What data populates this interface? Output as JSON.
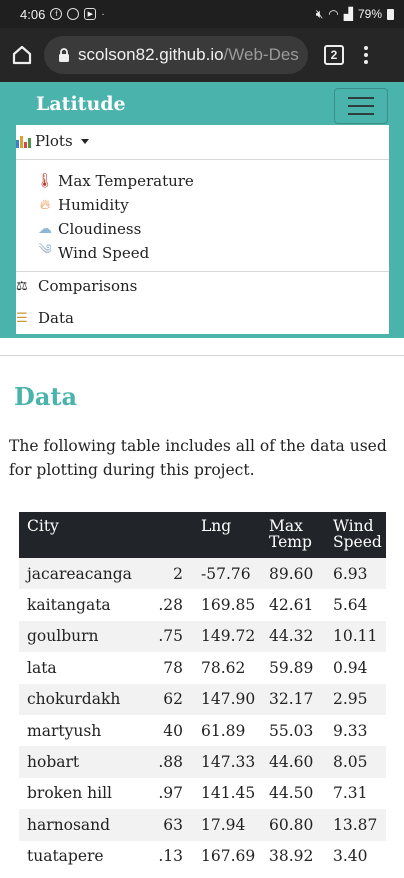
{
  "status_bar": {
    "time": "4:06",
    "battery": "79%"
  },
  "browser": {
    "url_host": "scolson82.github.io",
    "url_path": "/Web-Des",
    "tab_count": "2"
  },
  "navbar": {
    "brand": "Latitude",
    "plots_label": "Plots",
    "dropdown": [
      {
        "label": "Max Temperature",
        "icon": "thermometer-icon"
      },
      {
        "label": "Humidity",
        "icon": "fire-icon"
      },
      {
        "label": "Cloudiness",
        "icon": "cloud-icon"
      },
      {
        "label": "Wind Speed",
        "icon": "wind-icon"
      }
    ],
    "comparisons_label": "Comparisons",
    "data_label": "Data"
  },
  "page": {
    "title": "Data",
    "intro": "The following table includes all of the data used for plotting during this project."
  },
  "table": {
    "headers": [
      "City",
      "",
      "Lng",
      "Max\nTemp",
      "Wind\nSpeed"
    ],
    "header_lines": {
      "city": "City",
      "lat": "",
      "lng": "Lng",
      "max_temp_1": "Max",
      "max_temp_2": "Temp",
      "wind_1": "Wind",
      "wind_2": "Speed"
    },
    "rows": [
      [
        "jacareacanga",
        "2",
        "-57.76",
        "89.60",
        "6.93"
      ],
      [
        "kaitangata",
        ".28",
        "169.85",
        "42.61",
        "5.64"
      ],
      [
        "goulburn",
        ".75",
        "149.72",
        "44.32",
        "10.11"
      ],
      [
        "lata",
        "78",
        "78.62",
        "59.89",
        "0.94"
      ],
      [
        "chokurdakh",
        "62",
        "147.90",
        "32.17",
        "2.95"
      ],
      [
        "martyush",
        "40",
        "61.89",
        "55.03",
        "9.33"
      ],
      [
        "hobart",
        ".88",
        "147.33",
        "44.60",
        "8.05"
      ],
      [
        "broken hill",
        ".97",
        "141.45",
        "44.50",
        "7.31"
      ],
      [
        "harnosand",
        "63",
        "17.94",
        "60.80",
        "13.87"
      ],
      [
        "tuatapere",
        ".13",
        "167.69",
        "38.92",
        "3.40"
      ]
    ]
  },
  "colors": {
    "accent": "#4ab3ac",
    "table_header": "#212529",
    "stripe": "#f2f2f2"
  }
}
